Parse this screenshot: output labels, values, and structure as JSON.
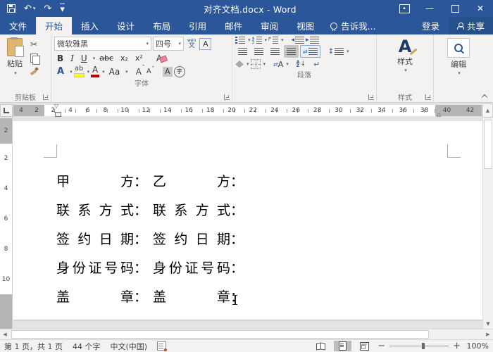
{
  "titlebar": {
    "title": "对齐文档.docx - Word"
  },
  "tabs": {
    "file": "文件",
    "items": [
      "开始",
      "插入",
      "设计",
      "布局",
      "引用",
      "邮件",
      "审阅",
      "视图"
    ],
    "tellme": "告诉我...",
    "signin": "登录",
    "share": "共享"
  },
  "ribbon": {
    "clipboard": {
      "paste": "粘贴",
      "label": "剪贴板"
    },
    "font": {
      "name": "微软雅黑",
      "size": "四号",
      "phonetic_top": "wén",
      "phonetic_bottom": "文",
      "bold": "B",
      "italic": "I",
      "underline": "U",
      "strike": "abc",
      "subscript": "x₂",
      "superscript": "x²",
      "clear": "A",
      "effects": "A",
      "highlight": "ab",
      "color": "A",
      "case": "Aa",
      "grow": "A",
      "shrink": "A",
      "char_shading": "A",
      "enclose": "字",
      "label": "字体"
    },
    "paragraph": {
      "label": "段落",
      "asian": "A",
      "sort_a": "A",
      "sort_z": "Z",
      "sort_arrow": "↓",
      "marks": "↵"
    },
    "styles": {
      "button": "样式",
      "label": "样式"
    },
    "editing": {
      "button": "编辑"
    }
  },
  "ruler": {
    "h_left": [
      "4",
      "2"
    ],
    "h_mid": [
      "2",
      "4",
      "6",
      "8",
      "10",
      "12",
      "14",
      "16",
      "18",
      "20",
      "22",
      "24",
      "26",
      "28",
      "30",
      "32",
      "34",
      "36",
      "38"
    ],
    "h_right": [
      "40",
      "42"
    ],
    "v_top": [
      "2"
    ],
    "v_mid": [
      "2",
      "4",
      "6",
      "8",
      "10"
    ]
  },
  "doc": {
    "colon": "：",
    "lines": [
      {
        "left": "甲方",
        "right": "乙方"
      },
      {
        "left": "联系方式",
        "right": "联系方式"
      },
      {
        "left": "签约日期",
        "right": "签约日期"
      },
      {
        "left": "身份证号码",
        "right": "身份证号码"
      },
      {
        "left": "盖章",
        "right": "盖章"
      }
    ]
  },
  "statusbar": {
    "page_info": "第 1 页，共 1 页",
    "word_count": "44 个字",
    "language": "中文(中国)",
    "zoom_level": "100%"
  },
  "colors": {
    "brand_blue": "#2b579a",
    "highlight_yellow": "#ffff00",
    "font_color_red": "#c00000"
  }
}
